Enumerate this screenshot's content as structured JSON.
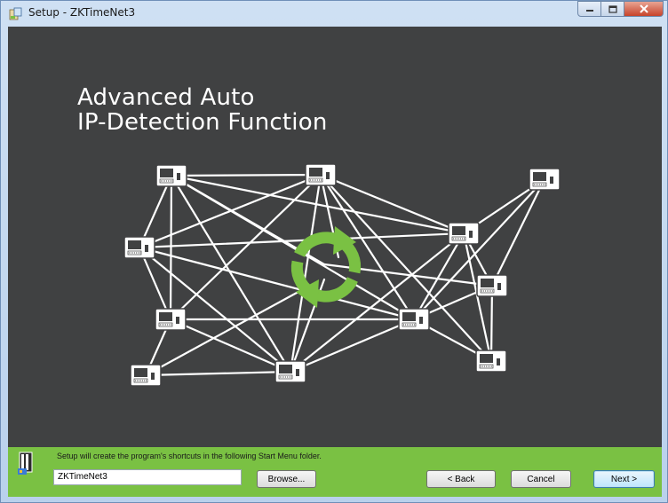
{
  "window": {
    "title": "Setup - ZKTimeNet3",
    "icon": "setup-package-icon"
  },
  "banner": {
    "heading_line1": "Advanced Auto",
    "heading_line2": "IP-Detection Function",
    "center_icon": "refresh-arrows-icon",
    "accent_color": "#7ac143",
    "background_color": "#404142"
  },
  "footer": {
    "message": "Setup will create the program's shortcuts in the following Start Menu folder.",
    "folder_value": "ZKTimeNet3",
    "browse_label": "Browse...",
    "back_label": "< Back",
    "cancel_label": "Cancel",
    "next_label": "Next >",
    "background_color": "#7ac143"
  }
}
